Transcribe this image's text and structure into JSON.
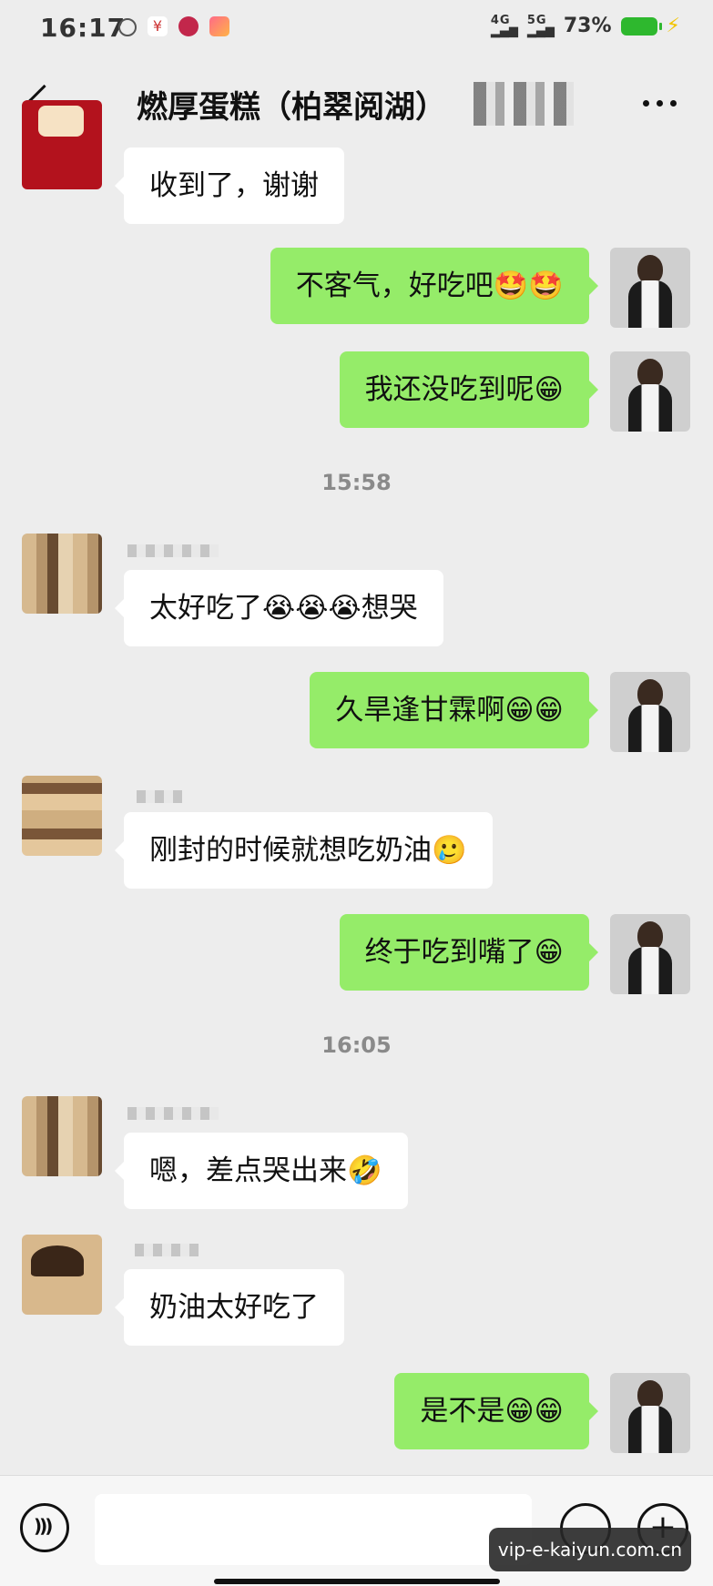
{
  "status_bar": {
    "time": "16:17",
    "network_1": "4G",
    "network_2": "5G",
    "battery": "73%"
  },
  "header": {
    "title": "燃厚蛋糕（柏翠阅湖）"
  },
  "messages": [
    {
      "side": "in",
      "text": "收到了，谢谢"
    },
    {
      "side": "out",
      "text": "不客气，好吃吧🤩🤩"
    },
    {
      "side": "out",
      "text": "我还没吃到呢😁"
    },
    {
      "side": "in",
      "text": "太好吃了😭😭😭想哭"
    },
    {
      "side": "out",
      "text": "久旱逢甘霖啊😁😁"
    },
    {
      "side": "in",
      "text": "刚封的时候就想吃奶油🥲"
    },
    {
      "side": "out",
      "text": "终于吃到嘴了😁"
    },
    {
      "side": "in",
      "text": "嗯，差点哭出来🤣"
    },
    {
      "side": "in",
      "text": "奶油太好吃了"
    },
    {
      "side": "out",
      "text": "是不是😁😁"
    }
  ],
  "timestamps": [
    "15:58",
    "16:05"
  ],
  "input": {
    "placeholder": ""
  },
  "watermark": "vip-e-kaiyun.com.cn",
  "icons": {
    "back": "chevron-left-icon",
    "more": "more-dots-icon",
    "voice": "voice-icon",
    "emoji": "emoji-icon",
    "plus": "plus-icon"
  },
  "colors": {
    "outgoing_bubble": "#95ec69",
    "incoming_bubble": "#ffffff",
    "background": "#ededed"
  }
}
